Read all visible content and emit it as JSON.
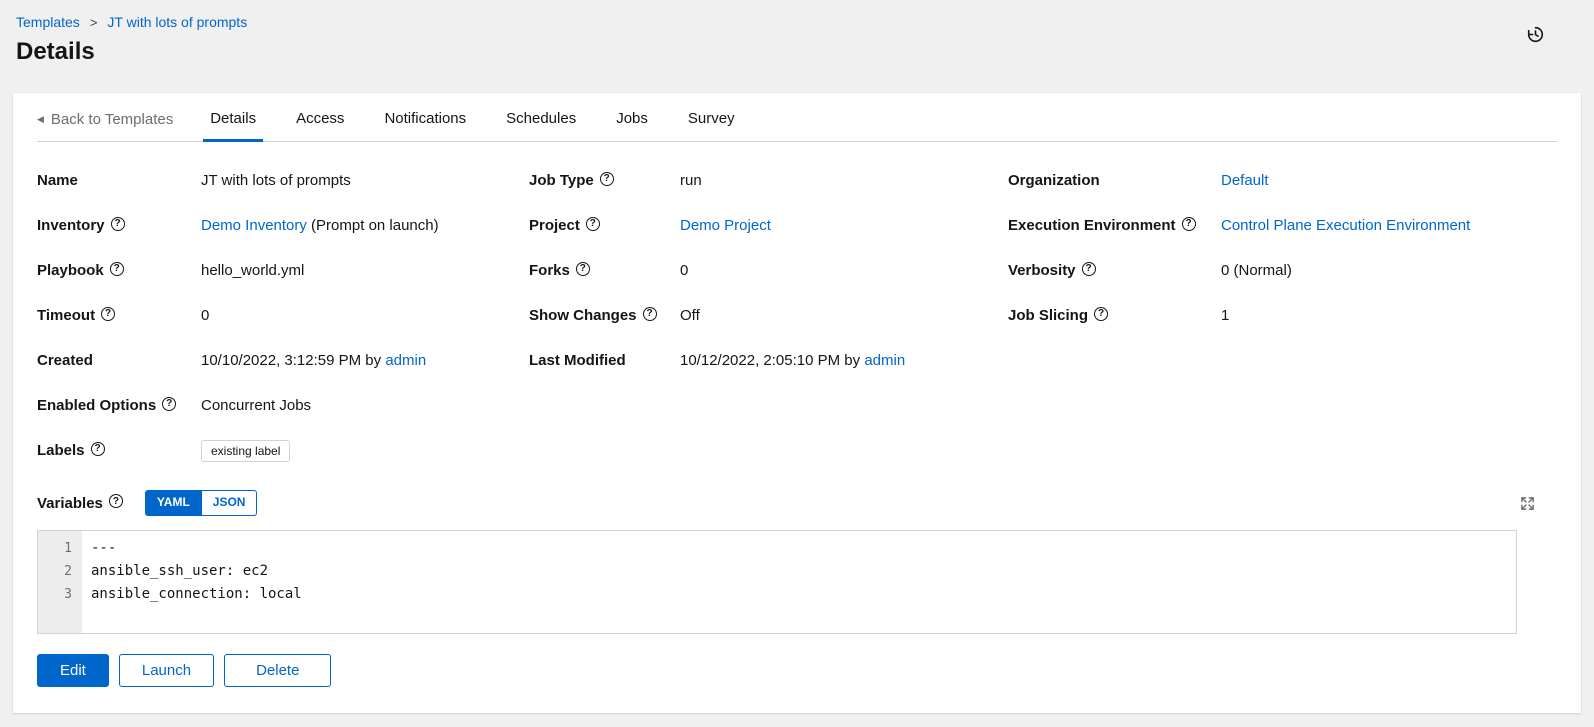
{
  "colors": {
    "link": "#0066cc",
    "primary": "#0066cc",
    "tab_underline": "#0066cc"
  },
  "icons": {
    "help": "?",
    "back": "◀"
  },
  "breadcrumb": {
    "items": [
      {
        "label": "Templates"
      },
      {
        "label": "JT with lots of prompts"
      }
    ],
    "separator": ">"
  },
  "page": {
    "title": "Details"
  },
  "tabs": {
    "back_label": "Back to Templates",
    "items": [
      "Details",
      "Access",
      "Notifications",
      "Schedules",
      "Jobs",
      "Survey"
    ],
    "active": "Details"
  },
  "details": {
    "name": {
      "label": "Name",
      "value": "JT with lots of prompts"
    },
    "inventory": {
      "label": "Inventory",
      "link": "Demo Inventory",
      "suffix": " (Prompt on launch)"
    },
    "playbook": {
      "label": "Playbook",
      "value": "hello_world.yml"
    },
    "timeout": {
      "label": "Timeout",
      "value": "0"
    },
    "created": {
      "label": "Created",
      "value": "10/10/2022, 3:12:59 PM by ",
      "link": "admin"
    },
    "enabled_options": {
      "label": "Enabled Options",
      "value": "Concurrent Jobs"
    },
    "labels_field": {
      "label": "Labels",
      "chips": [
        "existing label"
      ]
    },
    "variables": {
      "label": "Variables",
      "toggles": [
        "YAML",
        "JSON"
      ],
      "active_toggle": "YAML"
    },
    "job_type": {
      "label": "Job Type",
      "value": "run"
    },
    "project": {
      "label": "Project",
      "link": "Demo Project"
    },
    "forks": {
      "label": "Forks",
      "value": "0"
    },
    "show_changes": {
      "label": "Show Changes",
      "value": "Off"
    },
    "last_modified": {
      "label": "Last Modified",
      "value": "10/12/2022, 2:05:10 PM by ",
      "link": "admin"
    },
    "organization": {
      "label": "Organization",
      "link": "Default"
    },
    "execution_environment": {
      "label": "Execution Environment",
      "link": "Control Plane Execution Environment"
    },
    "verbosity": {
      "label": "Verbosity",
      "value": "0 (Normal)"
    },
    "job_slicing": {
      "label": "Job Slicing",
      "value": "1"
    }
  },
  "editor": {
    "lines": [
      {
        "number": "1",
        "code": "---"
      },
      {
        "number": "2",
        "code": "ansible_ssh_user: ec2"
      },
      {
        "number": "3",
        "code": "ansible_connection: local"
      }
    ]
  },
  "actions": {
    "edit": "Edit",
    "launch": "Launch",
    "delete": "Delete"
  }
}
